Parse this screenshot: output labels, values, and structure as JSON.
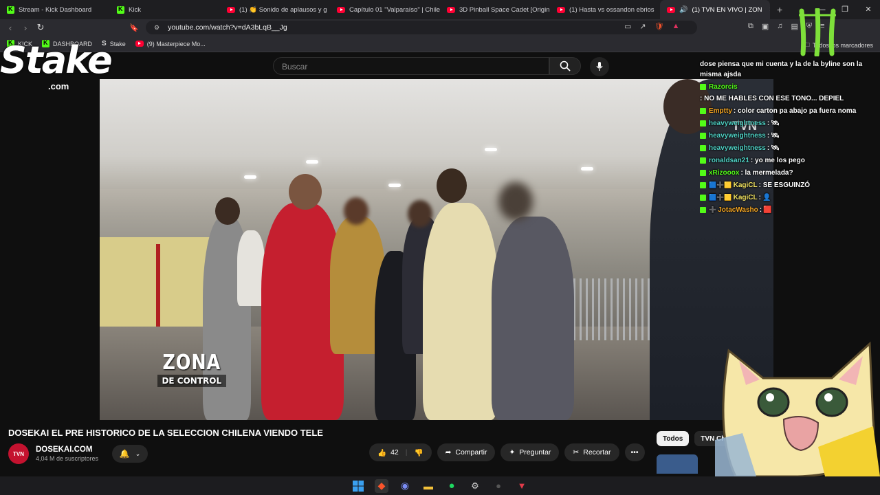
{
  "browser": {
    "tabs": [
      {
        "title": "Stream - Kick Dashboard",
        "icon": "kick-icon"
      },
      {
        "title": "Kick",
        "icon": "kick-icon"
      },
      {
        "title": "(1) 👏 Sonido de aplausos y g",
        "icon": "youtube-icon"
      },
      {
        "title": "Capítulo 01 \"Valparaíso\" | Chile",
        "icon": "youtube-icon"
      },
      {
        "title": "3D Pinball Space Cadet [Origin",
        "icon": "youtube-icon"
      },
      {
        "title": "(1) Hasta vs ossandon ebrios",
        "icon": "youtube-icon"
      },
      {
        "title": "(1) TVN EN VIVO | ZON",
        "icon": "youtube-icon"
      }
    ],
    "url": "youtube.com/watch?v=dA3bLqB__Jg",
    "bookmarks": [
      {
        "label": "KICK",
        "icon": "kick-icon"
      },
      {
        "label": "DASHBOARD",
        "icon": "kick-icon"
      },
      {
        "label": "Stake",
        "icon": "stake-icon"
      },
      {
        "label": "(9) Masterpiece Mo...",
        "icon": "youtube-icon"
      }
    ],
    "bookmarks_right": "Todos los marcadores"
  },
  "youtube": {
    "search_placeholder": "Buscar",
    "video_title": "DOSEKAI EL PRE HISTORICO DE LA SELECCION CHILENA VIENDO TELE",
    "channel_name": "DOSEKAI.COM",
    "channel_avatar_text": "TVN",
    "subscribers": "4,04 M de suscriptores",
    "likes": "42",
    "share_label": "Compartir",
    "ask_label": "Preguntar",
    "clip_label": "Recortar",
    "chips": [
      "Todos",
      "TVN Chi"
    ],
    "overlay_zona": "ZONA",
    "overlay_control": "DE CONTROL",
    "watermark": "TVN"
  },
  "chat": [
    {
      "user": "",
      "color": "#ffffff",
      "text": "dose piensa que mi cuenta y la de la byline son la misma ajsda"
    },
    {
      "user": "Razorcis",
      "color": "#53fc18",
      "text": ": NO ME HABLES CON ESE TONO... DEPIEL"
    },
    {
      "user": "Emptty",
      "color": "#f5a623",
      "text": ": color carton pa abajo pa fuera noma"
    },
    {
      "user": "heavyweightness",
      "color": "#4fd1c5",
      "text": ":"
    },
    {
      "user": "heavyweightness",
      "color": "#4fd1c5",
      "text": ":"
    },
    {
      "user": "heavyweightness",
      "color": "#4fd1c5",
      "text": ":"
    },
    {
      "user": "ronaldsan21",
      "color": "#4fd1c5",
      "text": ": yo me los pego"
    },
    {
      "user": "xRizooox",
      "color": "#53fc18",
      "text": ": la mermelada?"
    },
    {
      "user": "KagiCL",
      "color": "#f5e663",
      "text": ": SE ESGUINZÓ"
    },
    {
      "user": "KagiCL",
      "color": "#f5e663",
      "text": ":"
    },
    {
      "user": "JotacWasho",
      "color": "#f5a623",
      "text": ":"
    }
  ],
  "stream_overlay": {
    "stake_text": "Stake",
    "stake_com": ".com"
  },
  "colors": {
    "kick_green": "#53fc18",
    "youtube_red": "#ff0033",
    "bg": "#0f0f0f"
  }
}
